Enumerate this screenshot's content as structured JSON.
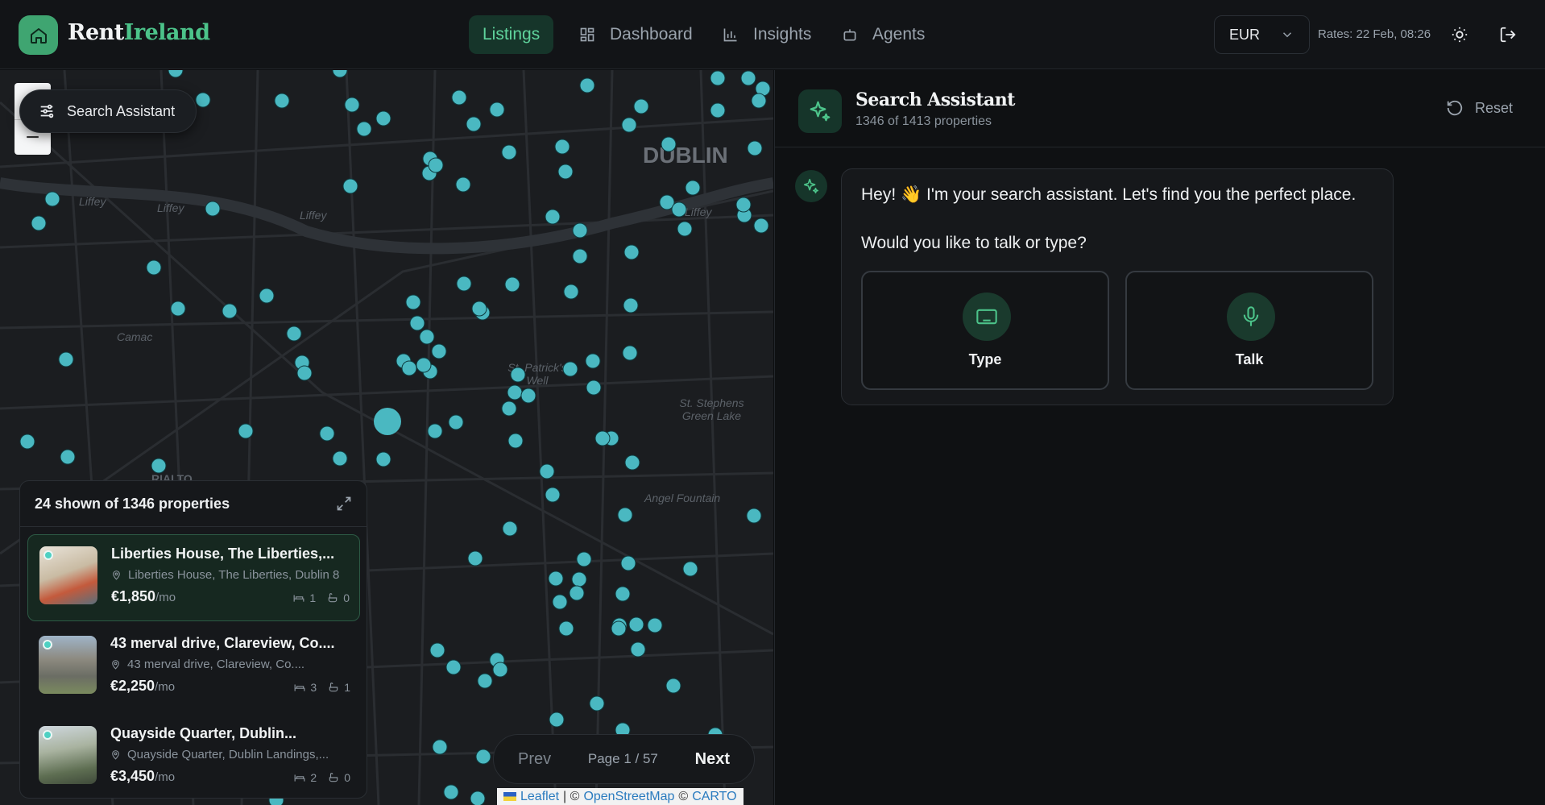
{
  "brand": {
    "name_part1": "Rent",
    "name_part2": "Ireland"
  },
  "nav": [
    {
      "label": "Listings",
      "icon": "list-icon",
      "active": true
    },
    {
      "label": "Dashboard",
      "icon": "dashboard-grid-icon",
      "active": false
    },
    {
      "label": "Insights",
      "icon": "bar-chart-icon",
      "active": false
    },
    {
      "label": "Agents",
      "icon": "robot-icon",
      "active": false
    }
  ],
  "currency": {
    "selected": "EUR"
  },
  "rates": "Rates: 22 Feb, 08:26",
  "map": {
    "search_pill_label": "Search Assistant",
    "zoom_out": "−",
    "labels": [
      "DUBLIN",
      "Liffey",
      "Liffey",
      "Liffey",
      "Liffey",
      "St. Patrick's Well",
      "St. Stephens Green Lake",
      "Angel Fountain",
      "Camac",
      "RIALTO"
    ],
    "attribution": {
      "leaflet": "Leaflet",
      "sep1": "| ©",
      "osm": "OpenStreetMap",
      "sep2": "©",
      "carto": "CARTO"
    },
    "marker_color": "#4ab8c1"
  },
  "listings_panel": {
    "header": "24 shown of 1346 properties",
    "items": [
      {
        "title": "Liberties House, The Liberties,...",
        "address": "Liberties House, The Liberties, Dublin 8",
        "price": "€1,850",
        "per": "/mo",
        "beds": "1",
        "baths": "0",
        "selected": true
      },
      {
        "title": "43 merval drive, Clareview, Co....",
        "address": "43 merval drive, Clareview, Co....",
        "price": "€2,250",
        "per": "/mo",
        "beds": "3",
        "baths": "1",
        "selected": false
      },
      {
        "title": "Quayside Quarter, Dublin...",
        "address": "Quayside Quarter, Dublin Landings,...",
        "price": "€3,450",
        "per": "/mo",
        "beds": "2",
        "baths": "0",
        "selected": false
      }
    ]
  },
  "pager": {
    "prev": "Prev",
    "page": "Page 1 / 57",
    "next": "Next"
  },
  "assistant": {
    "title": "Search Assistant",
    "subtitle": "1346 of 1413 properties",
    "reset": "Reset",
    "message_line1": "Hey! 👋 I'm your search assistant. Let's find you the perfect place.",
    "message_line2": "Would you like to talk or type?",
    "options": [
      {
        "label": "Type",
        "icon": "keyboard-icon"
      },
      {
        "label": "Talk",
        "icon": "microphone-icon"
      }
    ],
    "accent": "#4cc38a"
  }
}
